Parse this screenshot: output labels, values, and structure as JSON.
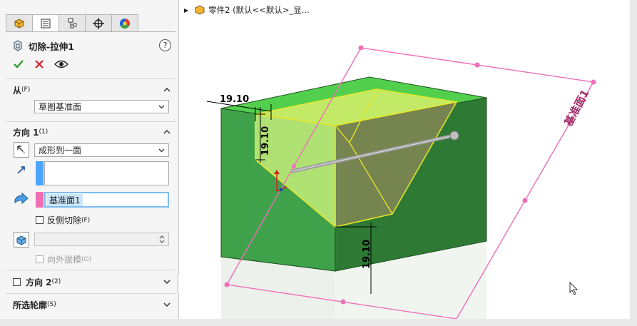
{
  "breadcrumb": {
    "text": "零件2 (默认<<默认>_显..."
  },
  "feature": {
    "title": "切除-拉伸1",
    "help": "?"
  },
  "sections": {
    "from": {
      "label": "从",
      "hotkey": "(F)",
      "start_value": "草图基准面"
    },
    "dir1": {
      "label": "方向 1",
      "hotkey": "(1)",
      "end_condition": "成形到一面",
      "face_selection": "基准面1",
      "flip_label": "反侧切除",
      "flip_hotkey": "(F)",
      "draft_label": "向外拔模",
      "draft_hotkey": "(O)"
    },
    "dir2": {
      "label": "方向 2",
      "hotkey": "(2)"
    },
    "contours": {
      "label": "所选轮廓",
      "hotkey": "(S)"
    }
  },
  "model": {
    "dimensions": [
      "19.10",
      "19.10",
      "19.10"
    ],
    "plane_label": "基准面1"
  },
  "colors": {
    "green_face": "#3e9e48",
    "green_top": "#4fcf4a",
    "yellow_edge": "#e8e82a",
    "plane_pink": "#ef6fb8",
    "cut_face": "#b8e06a",
    "selection_blue": "#4da3ff",
    "selection_pink": "#f06eb4"
  }
}
